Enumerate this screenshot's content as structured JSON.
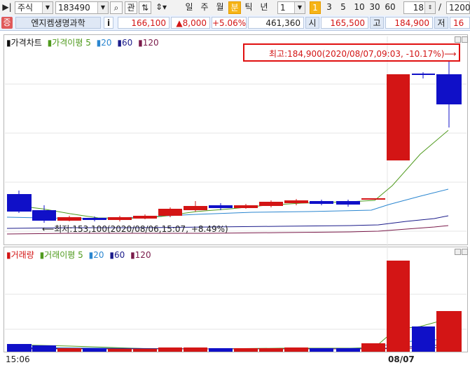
{
  "toolbar": {
    "market_type": "주식",
    "stock_code": "183490",
    "search_icon": "search-icon",
    "btn_gwan": "관",
    "period_buttons": [
      "일",
      "주",
      "월",
      "분",
      "틱",
      "년"
    ],
    "period_selected": "분",
    "interval_value": "1",
    "interval_buttons": [
      "1",
      "3",
      "5",
      "10",
      "30",
      "60"
    ],
    "interval_selected": "1",
    "count_value": "18",
    "slash": "/",
    "total_value": "1200"
  },
  "info": {
    "badge": "증",
    "stock_name": "엔지켐생명과학",
    "info_icon": "i",
    "price": "166,100",
    "change": "▲8,000",
    "change_pct": "+5.06%",
    "volume": "461,360",
    "open_label": "시",
    "open_value": "165,500",
    "high_label": "고",
    "high_value": "184,900",
    "low_label": "저",
    "low_value": "16"
  },
  "price_chart": {
    "legend": [
      {
        "text": "가격차트",
        "color": "#111111"
      },
      {
        "text": "가격이평 5",
        "color": "#4f9a1d"
      },
      {
        "text": "20",
        "color": "#2a86d0"
      },
      {
        "text": "60",
        "color": "#1b1b8a"
      },
      {
        "text": "120",
        "color": "#7a1a4a"
      }
    ],
    "high_annotation": "최고:184,900(2020/08/07,09:03, -10.17%)⟶",
    "low_annotation": "⟵최저:153,100(2020/08/06,15:07, +8.49%)"
  },
  "volume_chart": {
    "legend": [
      {
        "text": "거래량",
        "color": "#d31515"
      },
      {
        "text": "거래이평 5",
        "color": "#4f9a1d"
      },
      {
        "text": "20",
        "color": "#2a86d0"
      },
      {
        "text": "60",
        "color": "#1b1b8a"
      },
      {
        "text": "120",
        "color": "#7a1a4a"
      }
    ]
  },
  "x_axis": [
    "15:06",
    "08/07"
  ],
  "colors": {
    "up": "#d31515",
    "down": "#1010c8",
    "ma5": "#4f9a1d",
    "ma20": "#2a86d0",
    "ma60": "#1b1b8a",
    "ma120": "#7a1a4a"
  }
}
